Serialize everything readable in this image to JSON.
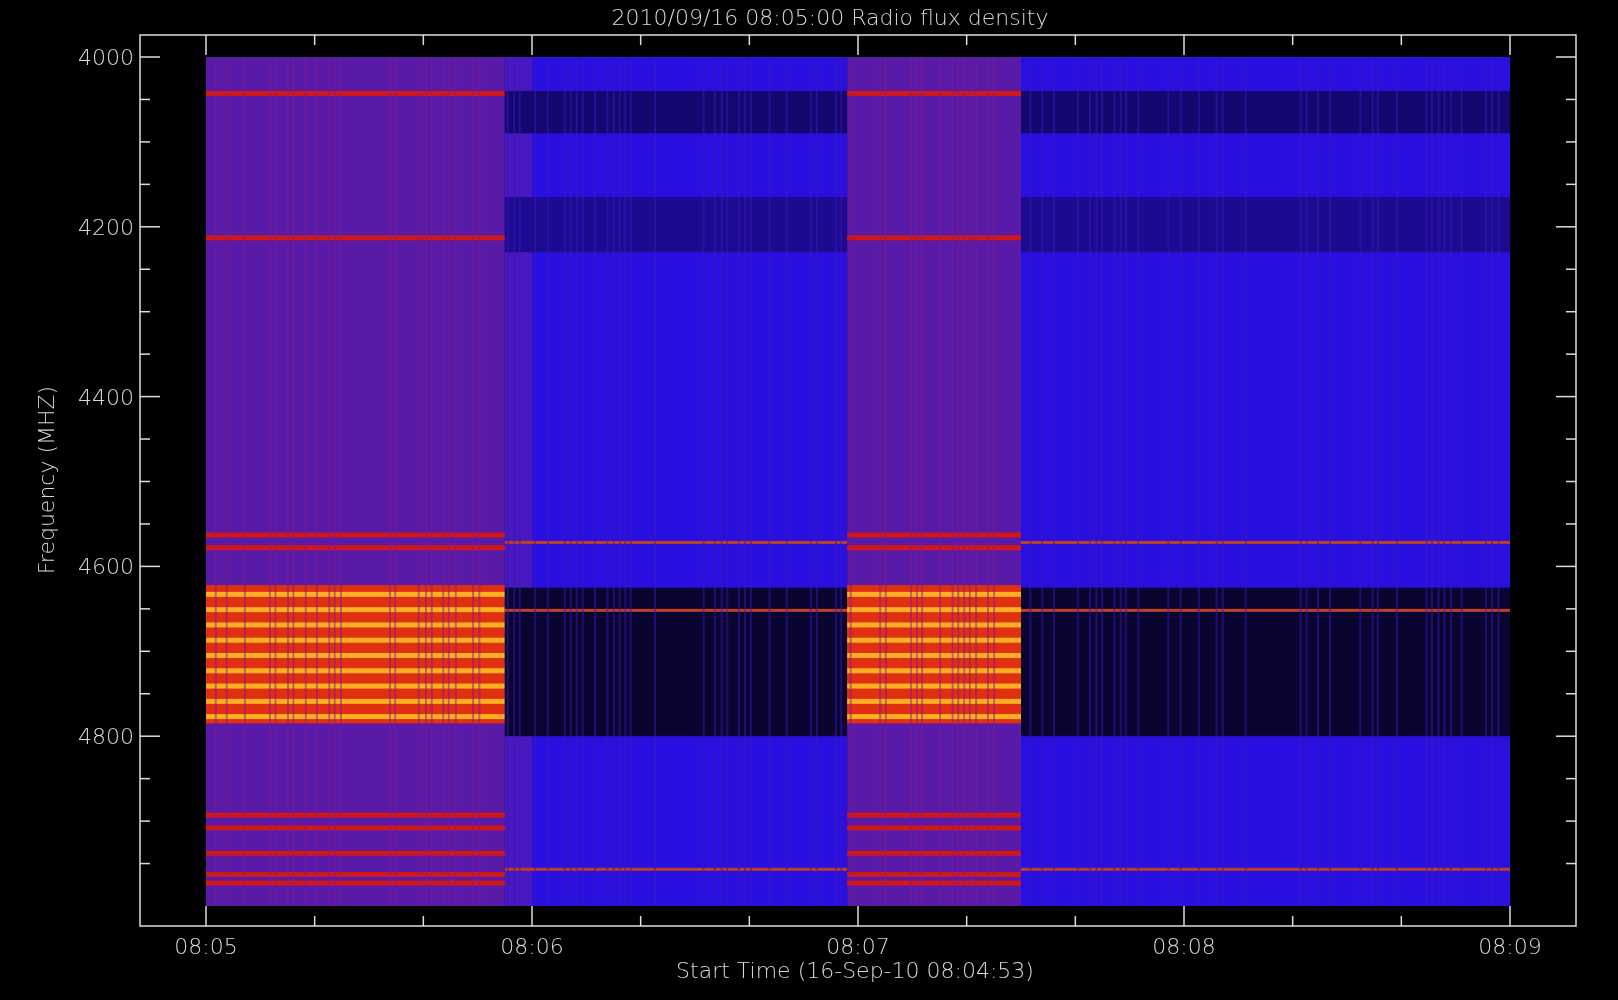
{
  "title": "2010/09/16 08:05:00 Radio flux density",
  "y_axis": {
    "label": "Frequency (MHZ)",
    "ticks": [
      "4000",
      "4200",
      "4400",
      "4600",
      "4800"
    ]
  },
  "x_axis": {
    "label": "Start Time (16-Sep-10 08:04:53)",
    "ticks": [
      "08:05",
      "08:06",
      "08:07",
      "08:08",
      "08:09"
    ]
  }
}
